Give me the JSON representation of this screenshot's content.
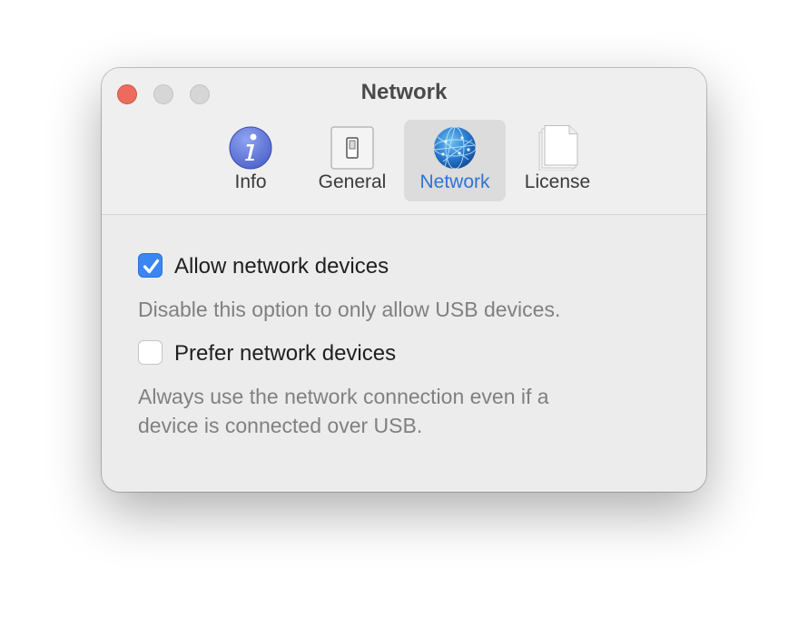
{
  "window": {
    "title": "Network"
  },
  "tabs": [
    {
      "label": "Info",
      "icon": "info-icon",
      "selected": false
    },
    {
      "label": "General",
      "icon": "switch-icon",
      "selected": false
    },
    {
      "label": "Network",
      "icon": "globe-icon",
      "selected": true
    },
    {
      "label": "License",
      "icon": "document-icon",
      "selected": false
    }
  ],
  "settings": {
    "allow_network": {
      "label": "Allow network devices",
      "checked": true,
      "description": "Disable this option to only allow USB devices."
    },
    "prefer_network": {
      "label": "Prefer network devices",
      "checked": false,
      "description": "Always use the network connection even if a\ndevice is connected over USB."
    }
  },
  "colors": {
    "accent": "#3a86f5",
    "selected_tab_text": "#2f73d8",
    "close_button": "#ed6a5e",
    "window_bg": "#ececec"
  }
}
